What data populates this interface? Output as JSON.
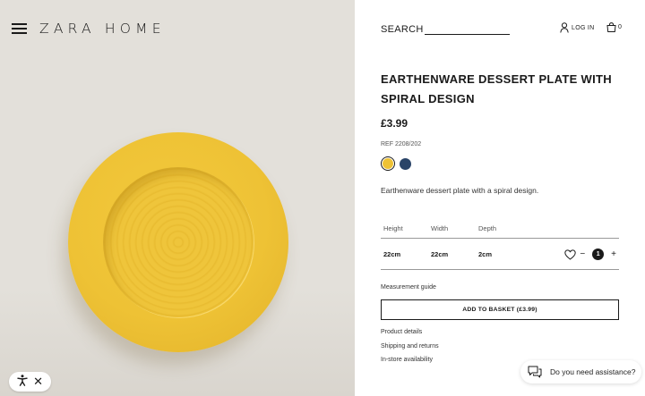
{
  "header": {
    "brand": "ZARA HOME",
    "search_label": "SEARCH",
    "login_label": "LOG IN",
    "bag_count": "0"
  },
  "product": {
    "title": "EARTHENWARE DESSERT PLATE WITH SPIRAL DESIGN",
    "price": "£3.99",
    "ref": "REF 2208/202",
    "colors": [
      {
        "name": "yellow",
        "hex": "#eec235",
        "selected": true
      },
      {
        "name": "navy",
        "hex": "#2a4468",
        "selected": false
      }
    ],
    "description": "Earthenware dessert plate with a spiral design."
  },
  "dimensions": {
    "headers": [
      "Height",
      "Width",
      "Depth"
    ],
    "values": [
      "22cm",
      "22cm",
      "2cm"
    ]
  },
  "quantity": {
    "minus": "−",
    "value": "1",
    "plus": "+"
  },
  "actions": {
    "measurement_guide": "Measurement guide",
    "add_to_basket": "ADD TO BASKET (£3.99)"
  },
  "info_links": [
    "Product details",
    "Shipping and returns",
    "In-store availability"
  ],
  "assistant": {
    "label": "Do you need assistance?"
  },
  "accessibility": {
    "icon": "accessibility-icon",
    "close": "✕"
  },
  "icons": {
    "menu": "hamburger-icon",
    "user": "user-icon",
    "bag": "bag-icon",
    "wishlist": "heart-icon",
    "chat": "chat-icon"
  }
}
